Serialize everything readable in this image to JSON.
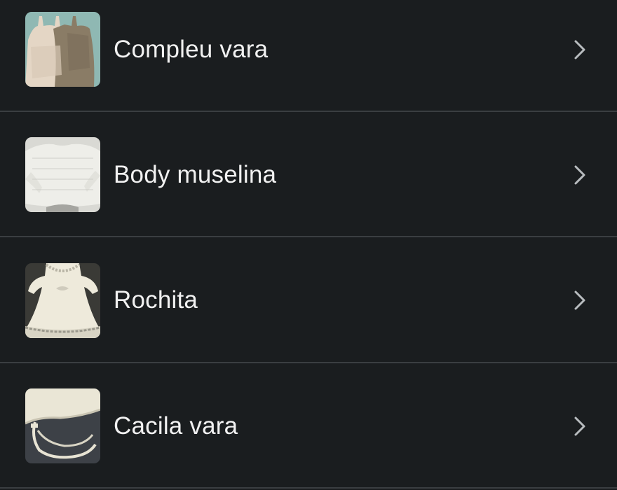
{
  "list": {
    "items": [
      {
        "label": "Compleu vara",
        "thumbnail": "summer-outfit-photo"
      },
      {
        "label": "Body muselina",
        "thumbnail": "muslin-bodysuit-photo"
      },
      {
        "label": "Rochita",
        "thumbnail": "dress-photo"
      },
      {
        "label": "Cacila vara",
        "thumbnail": "summer-bonnet-photo"
      }
    ],
    "chevron_icon": "chevron-right-icon"
  },
  "colors": {
    "background": "#1a1d1f",
    "divider": "#3a3e41",
    "text": "#f1f1f1",
    "chevron": "#b8bcbf"
  }
}
